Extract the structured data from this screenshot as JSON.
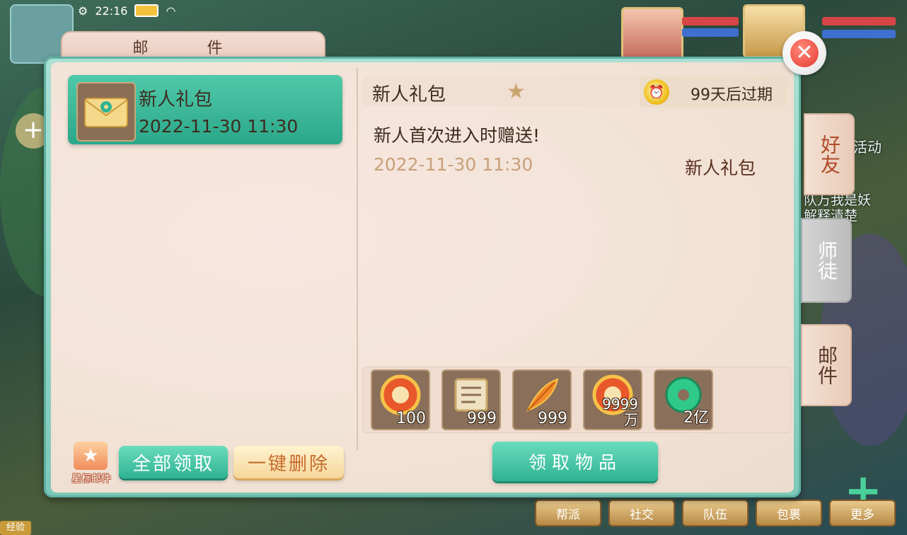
{
  "status": {
    "time": "22:16"
  },
  "panel": {
    "title": "邮 件"
  },
  "mail_list": [
    {
      "title": "新人礼包",
      "date": "2022-11-30 11:30"
    }
  ],
  "detail": {
    "title": "新人礼包",
    "expire": "99天后过期",
    "body": "新人首次进入时赠送!",
    "date": "2022-11-30 11:30",
    "from": "新人礼包",
    "attachments": [
      {
        "icon": "red-coin-icon",
        "qty": "100"
      },
      {
        "icon": "scroll-icon",
        "qty": "999"
      },
      {
        "icon": "feather-icon",
        "qty": "999"
      },
      {
        "icon": "red-coin-icon",
        "qty": "9999万"
      },
      {
        "icon": "jade-icon",
        "qty": "2亿"
      }
    ]
  },
  "buttons": {
    "star_mail": "星标邮件",
    "claim_all": "全部领取",
    "delete_all": "一键删除",
    "claim_items": "领取物品"
  },
  "side_tabs": {
    "friend": "好友",
    "mentor": "师徒",
    "mail": "邮件"
  },
  "background": {
    "bottom_buttons": [
      "帮派",
      "社交",
      "队伍",
      "包裹",
      "更多"
    ],
    "exp_label": "经验",
    "side_hint": "队万我是妖解释清楚",
    "activity": "活动"
  },
  "colors": {
    "accent_green": "#2fb393",
    "close_red": "#e43a30",
    "panel_bg": "#f3e4d8"
  }
}
